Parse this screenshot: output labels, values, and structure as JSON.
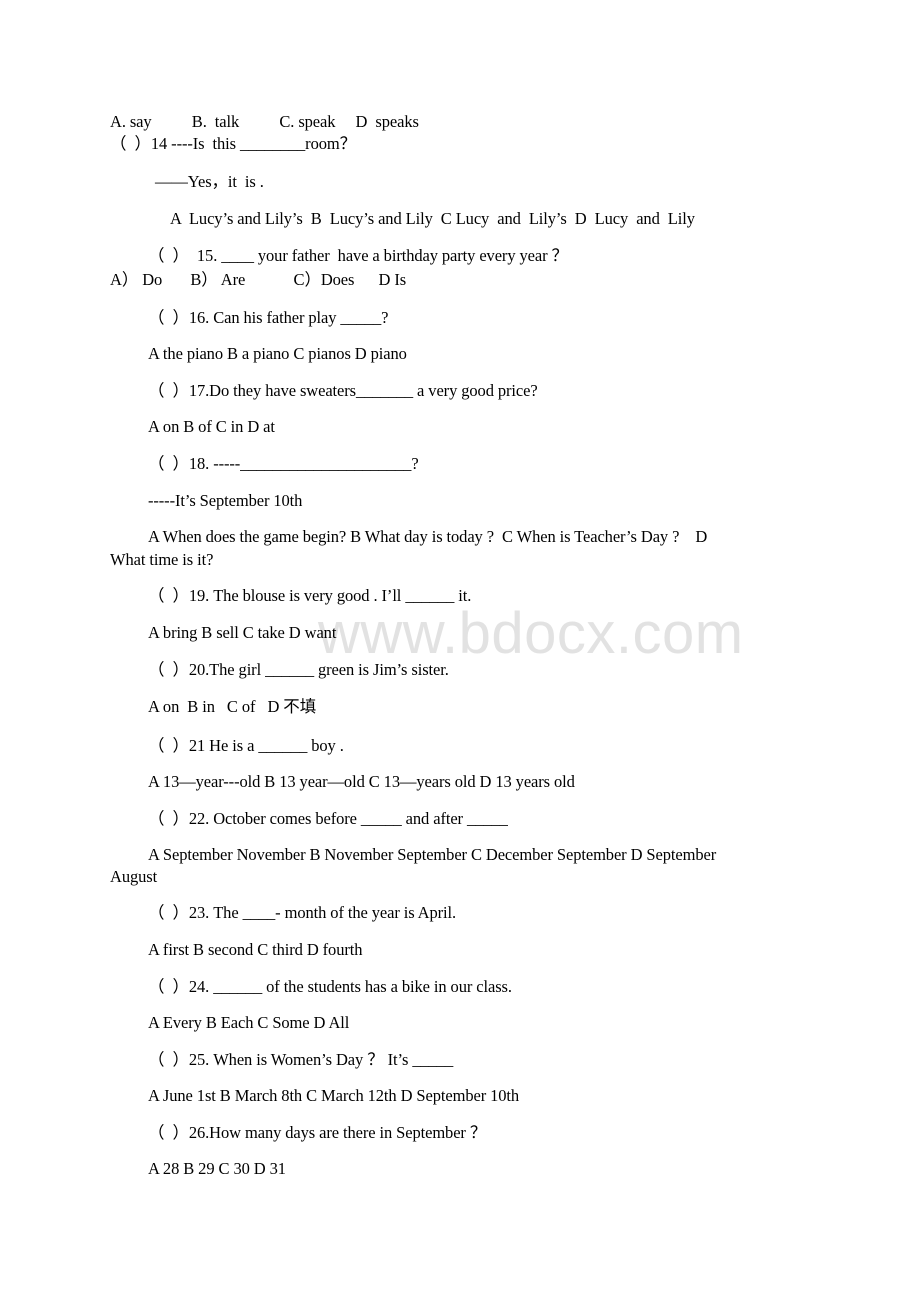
{
  "watermark": "www.bdocx.com",
  "lines": [
    "A. say          B.  talk          C. speak     D  speaks",
    "（  ）14 ----Is  this ________room？",
    "——Yes，it  is .",
    "A  Lucy’s and Lily’s  B  Lucy’s and Lily  C Lucy  and  Lily’s  D  Lucy  and  Lily",
    "（  ）  15. ____ your father  have a birthday party every year ？",
    "A） Do       B） Are            C）Does      D Is",
    "（  ）16. Can his father play _____?",
    "A the piano B a piano C pianos D piano",
    "（  ）17.Do they have sweaters_______ a very good price?",
    "A on B of C in D at",
    "（  ）18. -----_____________________?",
    "-----It’s September 10th",
    "A When does the game begin? B What day is today ?  C When is Teacher’s Day ?    D",
    "What time is it?",
    "（  ）19. The blouse is very good . I’ll ______ it.",
    "A bring B sell C take D want",
    "（  ）20.The girl ______ green is Jim’s sister.",
    "A on  B in   C of   D 不填",
    "（  ）21 He is a ______ boy .",
    "A 13—year---old B 13 year—old C 13—years old D 13 years old",
    "（  ）22. October comes before _____ and after _____",
    "A September November B November September C December September D September",
    "August",
    "（  ）23. The ____- month of the year is April.",
    "A first B second C third D fourth",
    "（  ）24. ______ of the students has a bike in our class.",
    "A Every B Each C Some D All",
    "（  ）25. When is Women’s Day ？ It’s _____",
    "A June 1st B March 8th C March 12th D September 10th",
    "（  ）26.How many days are there in September ？",
    "A 28 B 29 C 30 D 31"
  ]
}
